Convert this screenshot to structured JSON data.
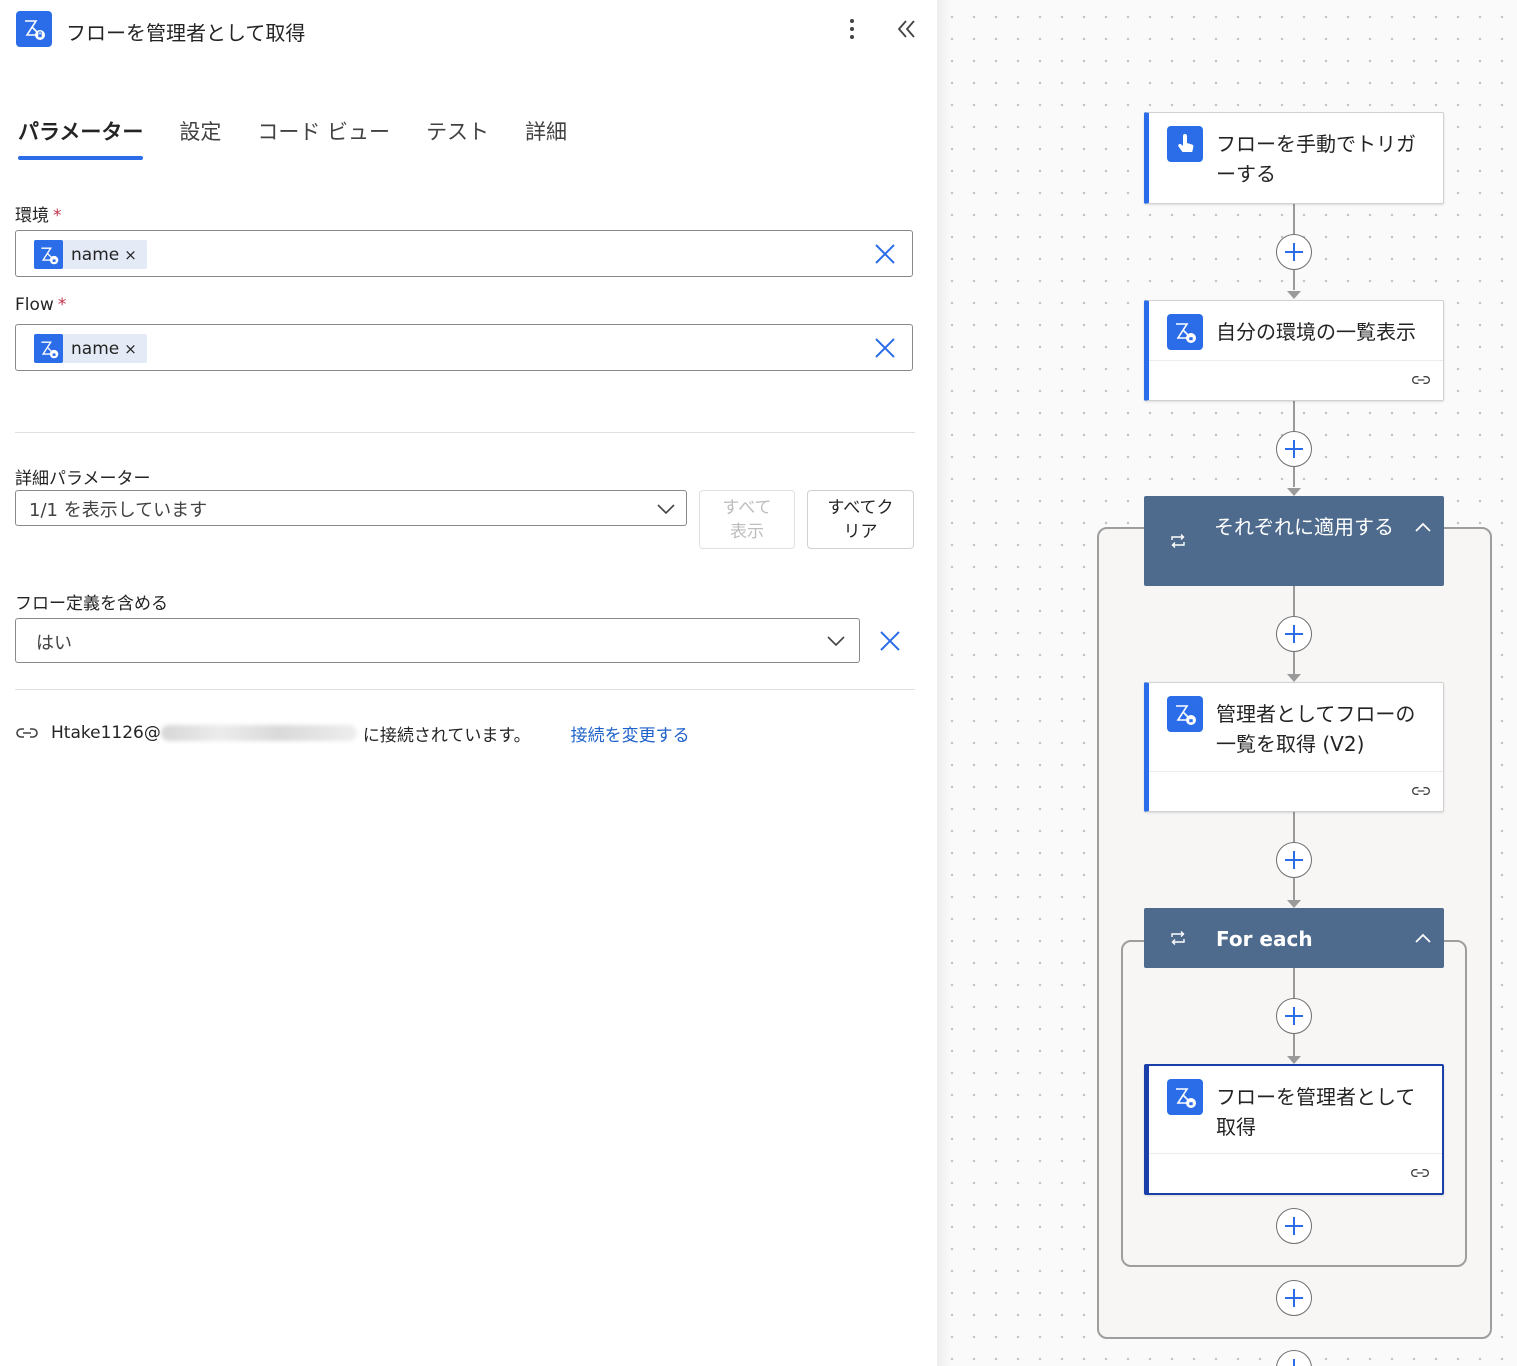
{
  "panel": {
    "title": "フローを管理者として取得",
    "tabs": [
      {
        "label": "パラメーター"
      },
      {
        "label": "設定"
      },
      {
        "label": "コード ビュー"
      },
      {
        "label": "テスト"
      },
      {
        "label": "詳細"
      }
    ],
    "environment": {
      "label": "環境",
      "required_mark": "*",
      "chip_text": "name",
      "chip_remove": "×"
    },
    "flow": {
      "label": "Flow",
      "required_mark": "*",
      "chip_text": "name",
      "chip_remove": "×"
    },
    "advanced": {
      "label": "詳細パラメーター",
      "selected": "1/1 を表示しています",
      "show_all_label": "すべて\n表示",
      "clear_all_label": "すべてク\nリア"
    },
    "include_definition": {
      "label": "フロー定義を含める",
      "selected": "はい"
    },
    "connection": {
      "account_prefix": "Htake1126@",
      "status_suffix": "に接続されています。",
      "change_link": "接続を変更する"
    }
  },
  "canvas": {
    "nodes": {
      "trigger": {
        "title": "フローを手動でトリガーする",
        "icon": "touch-trigger-icon"
      },
      "list_envs": {
        "title": "自分の環境の一覧表示",
        "icon": "power-automate-admin-icon"
      },
      "apply_each": {
        "title": "それぞれに適用する",
        "icon": "loop-icon"
      },
      "list_flows": {
        "title": "管理者としてフローの一覧を取得 (V2)",
        "icon": "power-automate-admin-icon"
      },
      "for_each": {
        "title": "For each",
        "icon": "loop-icon"
      },
      "get_flow": {
        "title": "フローを管理者として取得",
        "icon": "power-automate-admin-icon"
      }
    }
  },
  "colors": {
    "accent": "#2b6de8",
    "loop_header": "#4e6a8c",
    "link": "#1e62c9",
    "required": "#c4314b"
  }
}
